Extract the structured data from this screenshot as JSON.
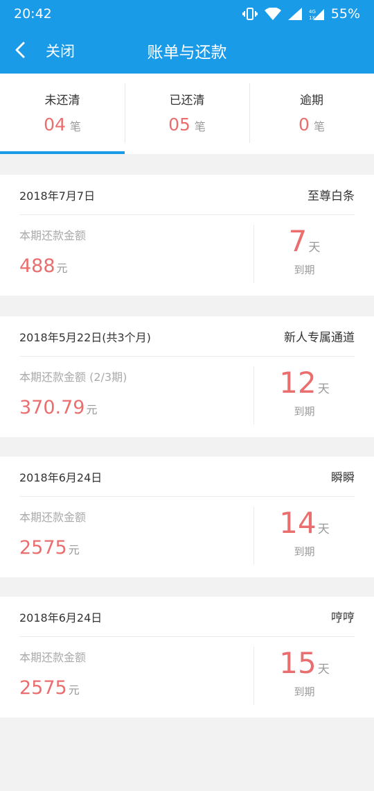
{
  "status_bar": {
    "time": "20:42",
    "battery": "55%"
  },
  "nav": {
    "close_label": "关闭",
    "title": "账单与还款"
  },
  "tabs": [
    {
      "label": "未还清",
      "count": "04",
      "unit": "笔"
    },
    {
      "label": "已还清",
      "count": "05",
      "unit": "笔"
    },
    {
      "label": "逾期",
      "count": "0",
      "unit": "笔"
    }
  ],
  "bills": [
    {
      "date": "2018年7月7日",
      "name": "至尊白条",
      "amount_label": "本期还款金额",
      "amount": "488",
      "amount_unit": "元",
      "days": "7",
      "days_unit": "天",
      "due_label": "到期"
    },
    {
      "date": "2018年5月22日(共3个月)",
      "name": "新人专属通道",
      "amount_label": "本期还款金额 (2/3期)",
      "amount": "370.79",
      "amount_unit": "元",
      "days": "12",
      "days_unit": "天",
      "due_label": "到期"
    },
    {
      "date": "2018年6月24日",
      "name": "瞬瞬",
      "amount_label": "本期还款金额",
      "amount": "2575",
      "amount_unit": "元",
      "days": "14",
      "days_unit": "天",
      "due_label": "到期"
    },
    {
      "date": "2018年6月24日",
      "name": "哼哼",
      "amount_label": "本期还款金额",
      "amount": "2575",
      "amount_unit": "元",
      "days": "15",
      "days_unit": "天",
      "due_label": "到期"
    }
  ],
  "colors": {
    "primary": "#1a9be8",
    "accent": "#ea6e6e",
    "muted": "#999999"
  }
}
